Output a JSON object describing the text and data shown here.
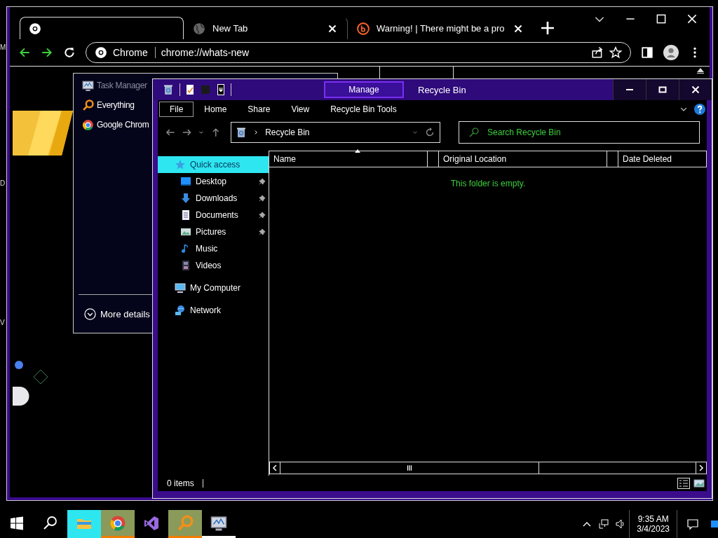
{
  "desktop": {
    "edge_labels": [
      "M",
      "D",
      "V"
    ]
  },
  "browser": {
    "tabs": [
      {
        "kind": "chrome",
        "selected": true
      },
      {
        "kind": "globe",
        "title": "New Tab",
        "selected": false
      },
      {
        "kind": "alert",
        "title": "Warning! | There might be a pro",
        "selected": false
      }
    ],
    "omnibox": {
      "chip": "Chrome",
      "url": "chrome://whats-new"
    }
  },
  "task_manager": {
    "items": [
      {
        "kind": "monitor",
        "label": "Task Manager",
        "disabled": true
      },
      {
        "kind": "magnifier",
        "label": "Everything",
        "disabled": false
      },
      {
        "kind": "chrome",
        "label": "Google Chrom",
        "disabled": false
      }
    ],
    "more_details": "More details"
  },
  "explorer": {
    "context_tab": "Manage",
    "title": "Recycle Bin",
    "ribbon_tabs": [
      {
        "label": "File",
        "selected": true
      },
      {
        "label": "Home",
        "selected": false
      },
      {
        "label": "Share",
        "selected": false
      },
      {
        "label": "View",
        "selected": false
      },
      {
        "label": "Recycle Bin Tools",
        "selected": false
      }
    ],
    "address": "Recycle Bin",
    "search": {
      "placeholder": "Search Recycle Bin"
    },
    "nav": [
      {
        "kind": "star",
        "label": "Quick access",
        "selected": true,
        "children": [
          {
            "kind": "desktop",
            "label": "Desktop",
            "selected": false,
            "pinned": true
          },
          {
            "kind": "download",
            "label": "Downloads",
            "selected": false,
            "pinned": true
          },
          {
            "kind": "document",
            "label": "Documents",
            "selected": false,
            "pinned": true
          },
          {
            "kind": "pictures",
            "label": "Pictures",
            "selected": false,
            "pinned": true
          },
          {
            "kind": "music",
            "label": "Music",
            "selected": false,
            "pinned": false
          },
          {
            "kind": "videos",
            "label": "Videos",
            "selected": false,
            "pinned": false
          }
        ]
      },
      {
        "kind": "computer",
        "label": "My Computer",
        "selected": false
      },
      {
        "kind": "network",
        "label": "Network",
        "selected": false
      }
    ],
    "columns": [
      "Name",
      "Original Location",
      "Date Deleted"
    ],
    "empty_message": "This folder is empty.",
    "status": "0 items"
  },
  "taskbar": {
    "apps": [
      {
        "kind": "folder",
        "active": true,
        "attention": false,
        "running": false
      },
      {
        "kind": "chrome",
        "active": false,
        "attention": true,
        "running": false
      },
      {
        "kind": "studio",
        "active": false,
        "attention": false,
        "running": false
      },
      {
        "kind": "magnifier",
        "active": false,
        "attention": true,
        "running": false
      },
      {
        "kind": "monitor",
        "active": false,
        "attention": false,
        "running": true
      }
    ],
    "time": "9:35 AM",
    "date": "3/4/2023"
  }
}
